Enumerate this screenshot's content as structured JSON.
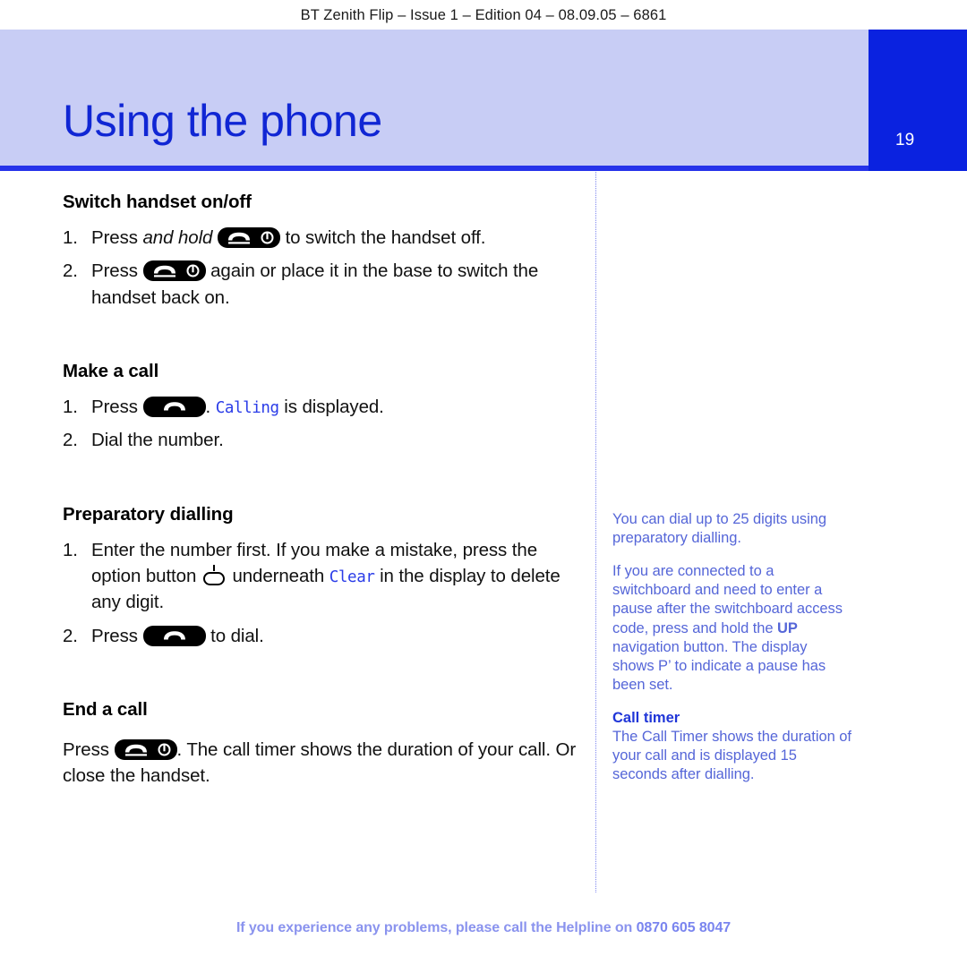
{
  "running_head": "BT Zenith Flip – Issue 1 – Edition 04 – 08.09.05 – 6861",
  "page_title": "Using the phone",
  "page_number": "19",
  "colors": {
    "banner_bg": "#c8cdf5",
    "banner_rule": "#2633ea",
    "folio_block": "#0a22e0",
    "title_text": "#1026d4",
    "sidebar_text": "#5566d8",
    "sidebar_heading": "#2036d8",
    "lcd_text": "#2a3ce8",
    "footer_text": "#8a93ee",
    "divider": "#7d86ef"
  },
  "sections": {
    "switch_handset": {
      "heading": "Switch handset on/off",
      "step1": {
        "num": "1.",
        "before": "Press ",
        "italic": "and hold",
        "after": " to switch the handset off."
      },
      "step2": {
        "num": "2.",
        "before": "Press ",
        "after": " again or place it in the base to switch the handset back on."
      }
    },
    "make_a_call": {
      "heading": "Make a call",
      "step1": {
        "num": "1.",
        "before": "Press ",
        "mid": ". ",
        "lcd": "Calling",
        "after": " is displayed."
      },
      "step2": {
        "num": "2.",
        "text": "Dial the number."
      }
    },
    "preparatory_dialling": {
      "heading": "Preparatory dialling",
      "step1": {
        "num": "1.",
        "before": "Enter the number first. If you make a mistake, press the option button ",
        "mid": " underneath ",
        "lcd": "Clear",
        "after": " in the display to delete any digit."
      },
      "step2": {
        "num": "2.",
        "before": "Press ",
        "after": " to dial."
      }
    },
    "end_a_call": {
      "heading": "End a call",
      "paragraph": {
        "before": "Press ",
        "after": ". The call timer shows the duration of your call. Or close the handset."
      }
    }
  },
  "sidebar": {
    "note1": "You can dial up to 25 digits using preparatory dialling.",
    "note2": {
      "part1": "If you are connected to a switchboard and need to enter a pause after the switchboard access code, press and hold the ",
      "bold": "UP",
      "part2": " navigation button. The display shows P’ to indicate a pause has been set."
    },
    "call_timer": {
      "heading": "Call timer",
      "text": "The Call Timer shows the duration of your call and is displayed 15 seconds after dialling."
    }
  },
  "footer": {
    "text": "If you experience any problems, please call the Helpline on ",
    "phone": "0870 605 8047"
  },
  "icons": {
    "talk_power_key": "talk-power-key-icon",
    "talk_key": "talk-key-icon",
    "option_key": "option-key-icon"
  }
}
